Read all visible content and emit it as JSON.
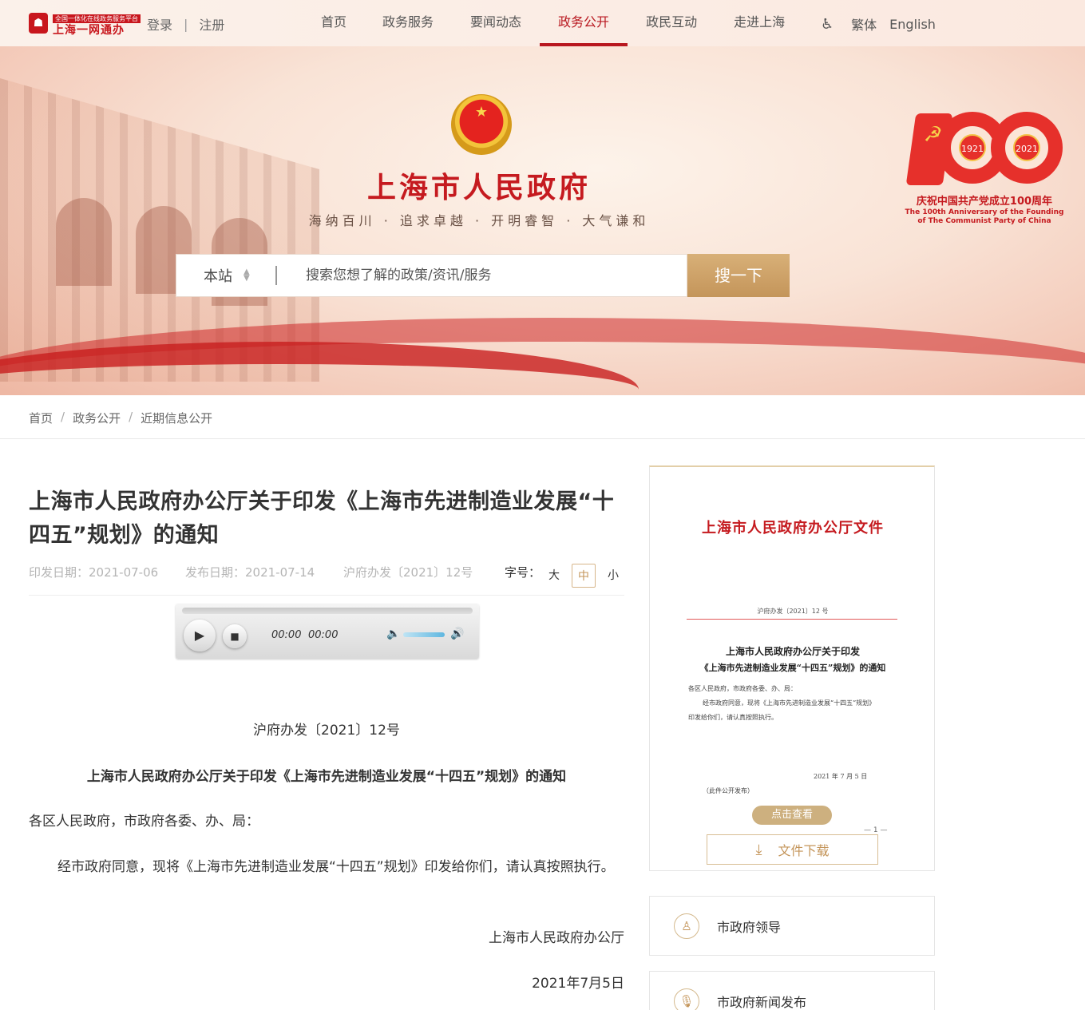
{
  "header": {
    "logo_small": "全国一体化在线政务服务平台",
    "logo_main": "上海一网通办",
    "login": "登录",
    "register": "注册",
    "nav": [
      {
        "label": "首页"
      },
      {
        "label": "政务服务"
      },
      {
        "label": "要闻动态"
      },
      {
        "label": "政务公开",
        "active": true
      },
      {
        "label": "政民互动"
      },
      {
        "label": "走进上海"
      }
    ],
    "accessibility_icon": "wheelchair-icon",
    "traditional": "繁体",
    "english": "English"
  },
  "banner": {
    "title": "上海市人民政府",
    "slogan": "海纳百川 · 追求卓越 · 开明睿智 · 大气谦和",
    "search": {
      "scope": "本站",
      "placeholder": "搜索您想了解的政策/资讯/服务",
      "button": "搜一下"
    },
    "anniversary": {
      "year1": "1921",
      "year2": "2021",
      "cn": "庆祝中国共产党成立100周年",
      "en": "The 100th Anniversary of the Founding of The Communist Party of China"
    }
  },
  "breadcrumb": [
    "首页",
    "政务公开",
    "近期信息公开"
  ],
  "article": {
    "title": "上海市人民政府办公厅关于印发《上海市先进制造业发展“十四五”规划》的通知",
    "issue_date": "印发日期：2021-07-06",
    "publish_date": "发布日期：2021-07-14",
    "doc_number_meta": "沪府办发〔2021〕12号",
    "fontsize_label": "字号：",
    "fontsize_options": [
      "大",
      "中",
      "小"
    ],
    "fontsize_active": "中",
    "player": {
      "current": "00:00",
      "duration": "00:00"
    },
    "doc_number": "沪府办发〔2021〕12号",
    "heading": "上海市人民政府办公厅关于印发《上海市先进制造业发展“十四五”规划》的通知",
    "addressee": "各区人民政府，市政府各委、办、局：",
    "body": "经市政府同意，现将《上海市先进制造业发展“十四五”规划》印发给你们，请认真按照执行。",
    "signature": "上海市人民政府办公厅",
    "date": "2021年7月5日"
  },
  "side": {
    "doc_preview": {
      "title": "上海市人民政府办公厅文件",
      "number": "沪府办发〔2021〕12 号",
      "h1": "上海市人民政府办公厅关于印发",
      "h2": "《上海市先进制造业发展“十四五”规划》的通知",
      "line1": "各区人民政府，市政府各委、办、局：",
      "line2": "经市政府同意，现将《上海市先进制造业发展“十四五”规划》",
      "line3": "印发给你们，请认真按照执行。",
      "date": "2021 年 7 月 5 日",
      "publish_note": "（此件公开发布）",
      "page": "— 1 —",
      "view_button": "点击查看"
    },
    "download": "文件下载",
    "links": [
      {
        "label": "市政府领导",
        "icon": "leader-icon"
      },
      {
        "label": "市政府新闻发布",
        "icon": "microphone-icon"
      }
    ]
  },
  "colors": {
    "brand_red": "#c51a1f",
    "accent_gold": "#c4955a"
  }
}
